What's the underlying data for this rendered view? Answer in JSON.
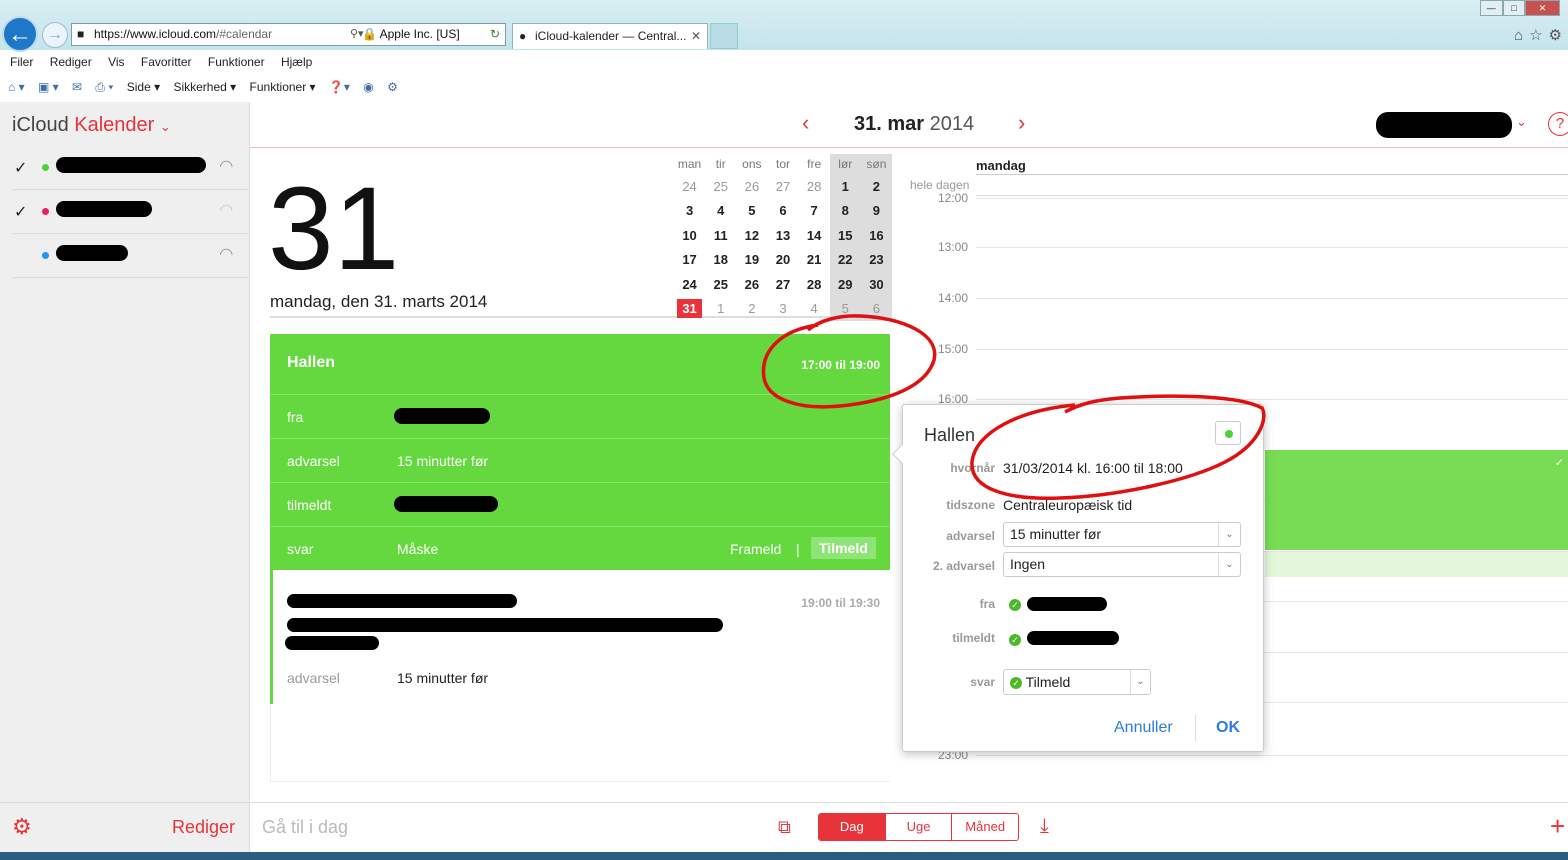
{
  "browser": {
    "url_prefix": "https://www.",
    "url_domain": "icloud.com",
    "url_path": "/#calendar",
    "secure_label": "Apple Inc. [US]",
    "tab_title": "iCloud-kalender — Central...",
    "menu": [
      "Filer",
      "Rediger",
      "Vis",
      "Favoritter",
      "Funktioner",
      "Hjælp"
    ],
    "commands": [
      "Side ▾",
      "Sikkerhed ▾",
      "Funktioner ▾"
    ]
  },
  "sidebar": {
    "app_name": "iCloud",
    "app_section": "Kalender",
    "calendars": [
      {
        "checked": true,
        "color": "#4cd137"
      },
      {
        "checked": true,
        "color": "#e91e63"
      },
      {
        "checked": false,
        "color": "#2196f3"
      }
    ],
    "edit_label": "Rediger"
  },
  "header": {
    "date_bold": "31. mar",
    "year": "2014"
  },
  "day": {
    "big_number": "31",
    "long_date": "mandag, den 31. marts 2014"
  },
  "mini_calendar": {
    "weekdays": [
      "man",
      "tir",
      "ons",
      "tor",
      "fre",
      "lør",
      "søn"
    ],
    "weeks": [
      [
        "24",
        "25",
        "26",
        "27",
        "28",
        "1",
        "2"
      ],
      [
        "3",
        "4",
        "5",
        "6",
        "7",
        "8",
        "9"
      ],
      [
        "10",
        "11",
        "12",
        "13",
        "14",
        "15",
        "16"
      ],
      [
        "17",
        "18",
        "19",
        "20",
        "21",
        "22",
        "23"
      ],
      [
        "24",
        "25",
        "26",
        "27",
        "28",
        "29",
        "30"
      ],
      [
        "31",
        "1",
        "2",
        "3",
        "4",
        "5",
        "6"
      ]
    ],
    "today": "31"
  },
  "event1": {
    "title": "Hallen",
    "time": "17:00 til 19:00",
    "from_label": "fra",
    "alert_label": "advarsel",
    "alert_value": "15 minutter før",
    "attending_label": "tilmeldt",
    "reply_label": "svar",
    "reply_value": "Måske",
    "decline": "Frameld",
    "accept": "Tilmeld"
  },
  "event2": {
    "time": "19:00 til 19:30",
    "alert_label": "advarsel",
    "alert_value": "15 minutter før"
  },
  "dayview": {
    "day_name": "mandag",
    "allday": "hele dagen",
    "hours": [
      "12:00",
      "13:00",
      "14:00",
      "15:00",
      "16:00",
      "23:00"
    ]
  },
  "popover": {
    "title": "Hallen",
    "when_label": "hvornår",
    "when_value": "31/03/2014 kl. 16:00 til 18:00",
    "tz_label": "tidszone",
    "tz_value": "Centraleuropæisk tid",
    "alert_label": "advarsel",
    "alert_value": "15 minutter før",
    "alert2_label": "2. advarsel",
    "alert2_value": "Ingen",
    "from_label": "fra",
    "attending_label": "tilmeldt",
    "reply_label": "svar",
    "reply_value": "Tilmeld",
    "cancel": "Annuller",
    "ok": "OK"
  },
  "footer": {
    "goto_today": "Gå til i dag",
    "views": [
      "Dag",
      "Uge",
      "Måned"
    ],
    "active_view": "Dag"
  },
  "colors": {
    "accent": "#e8333a",
    "event_green": "#64d83e",
    "link_blue": "#2b7dde"
  }
}
